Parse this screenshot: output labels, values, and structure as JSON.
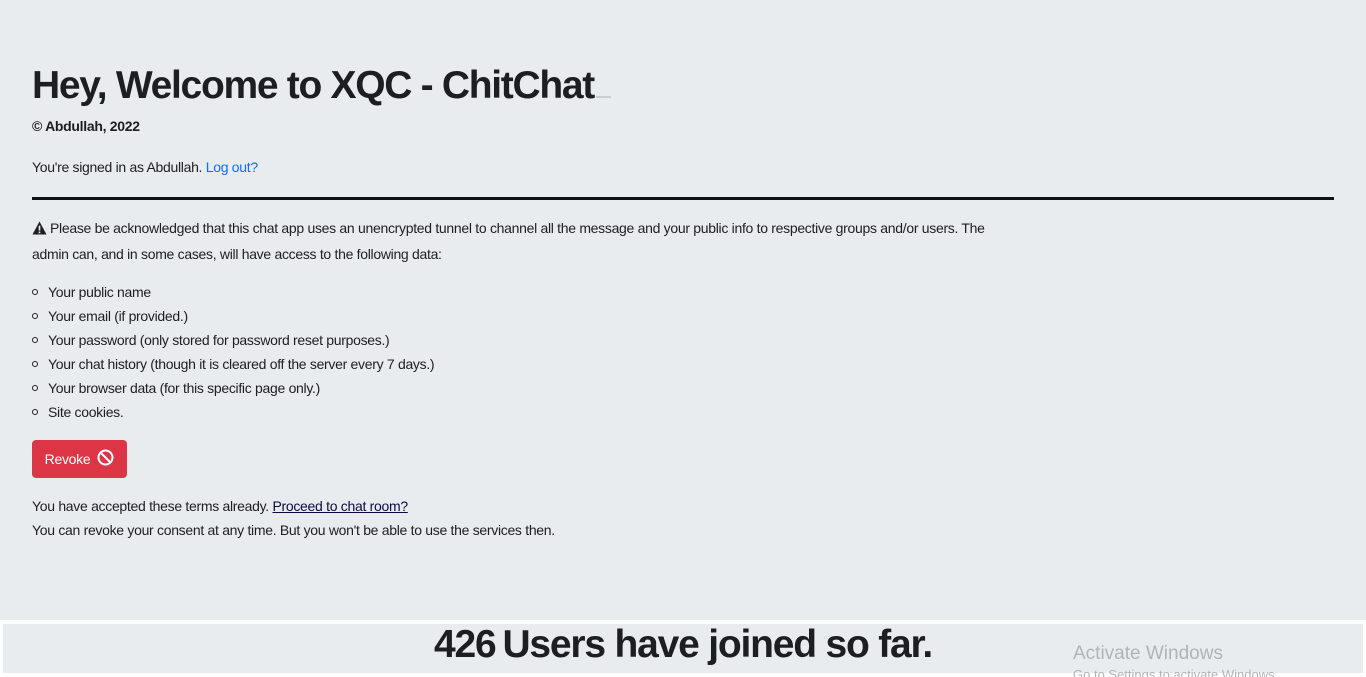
{
  "header": {
    "title": "Hey, Welcome to XQC - ChitChat",
    "copyright": "© Abdullah, 2022"
  },
  "session": {
    "signed_in_text": "You're signed in as Abdullah.",
    "logout_label": "Log out?"
  },
  "notice": {
    "warning_icon": "warning-triangle-icon",
    "text": "Please be acknowledged that this chat app uses an unencrypted tunnel to channel all the message and your public info to respective groups and/or users. The admin can, and in some cases, will have access to the following data:",
    "items": [
      "Your public name",
      "Your email (if provided.)",
      "Your password (only stored for password reset purposes.)",
      "Your chat history (though it is cleared off the server every 7 days.)",
      "Your browser data (for this specific page only.)",
      "Site cookies."
    ]
  },
  "revoke": {
    "label": "Revoke",
    "icon": "prohibited-icon",
    "color": "#dc3545"
  },
  "consent": {
    "accepted_text": "You have accepted these terms already.",
    "proceed_link": "Proceed to chat room?",
    "revoke_info": "You can revoke your consent at any time. But you won't be able to use the services then."
  },
  "stats": {
    "user_count": "426",
    "joined_text": "Users have joined so far."
  },
  "os_watermark": {
    "title": "Activate Windows",
    "subtitle": "Go to Settings to activate Windows."
  },
  "colors": {
    "background": "#e9ecef",
    "link": "#0d6efd",
    "danger": "#dc3545"
  }
}
